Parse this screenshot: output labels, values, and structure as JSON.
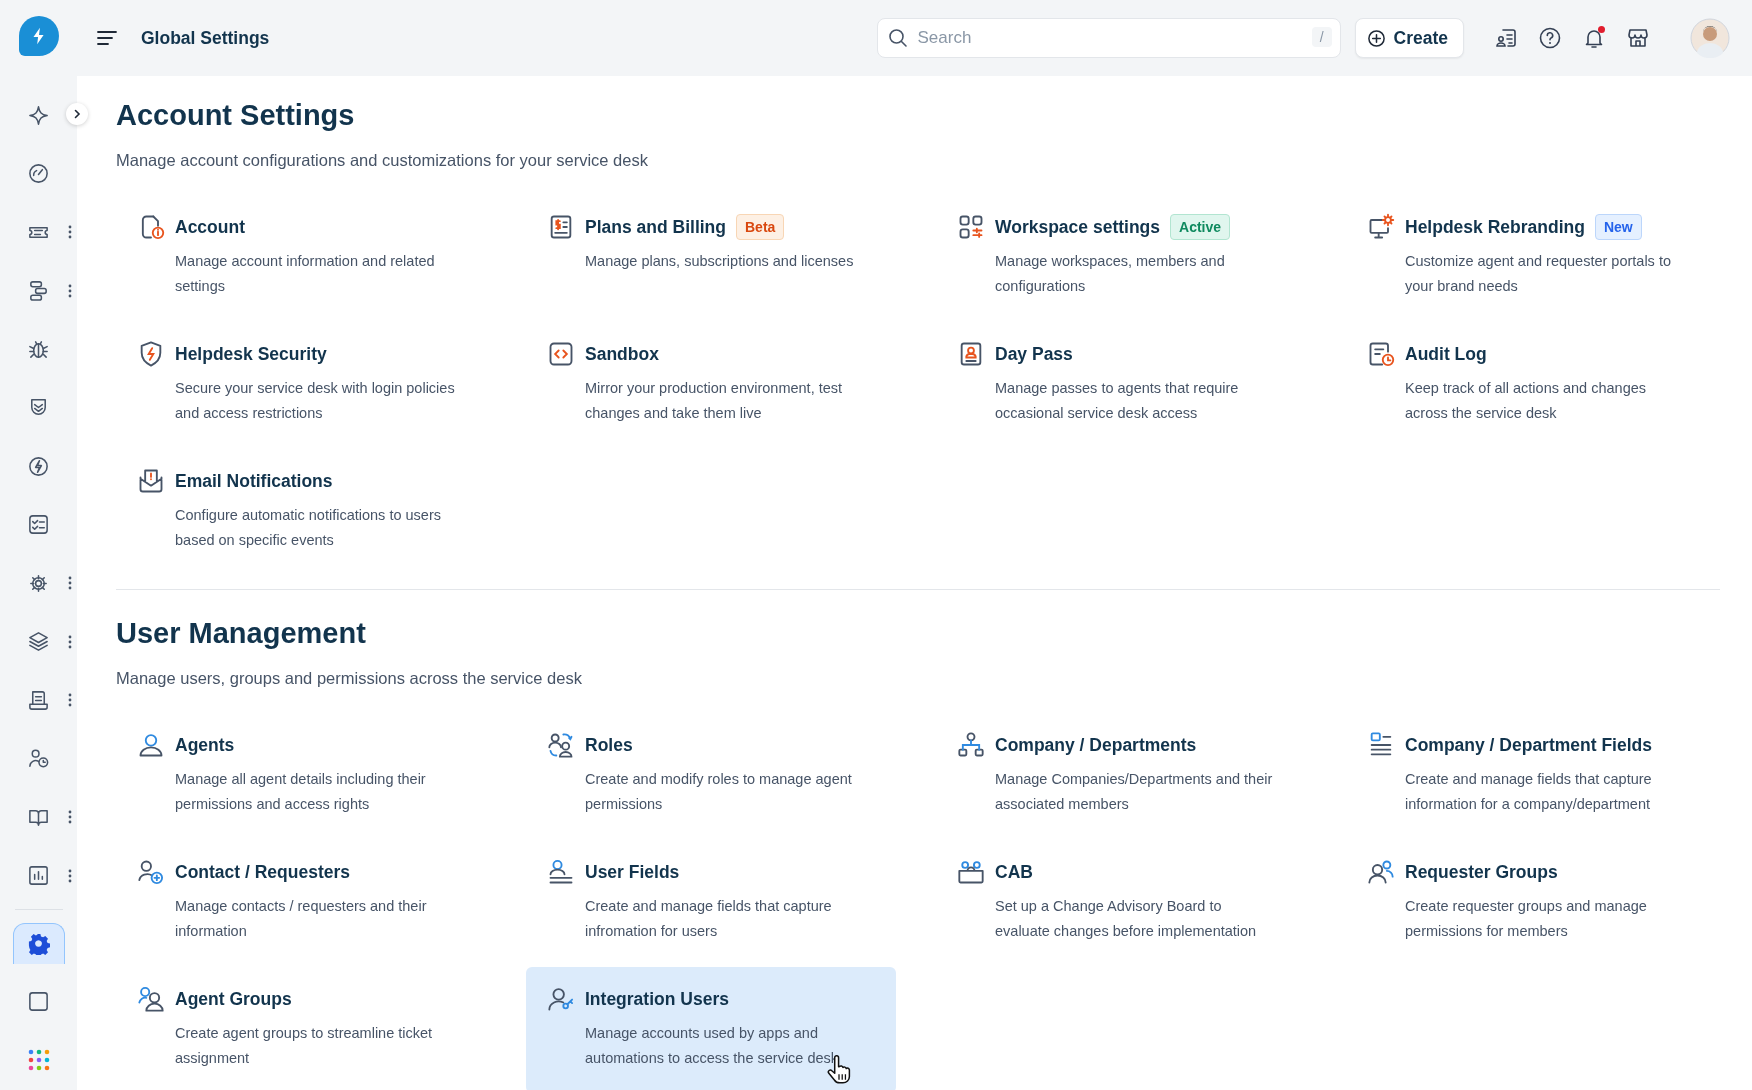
{
  "topbar": {
    "title": "Global Settings",
    "search": {
      "placeholder": "Search",
      "shortcut": "/"
    },
    "create_button": "Create",
    "notification_unread": true
  },
  "sidebar": {
    "items": [
      {
        "selected": false,
        "has_menu": false
      },
      {
        "selected": false,
        "has_menu": false
      },
      {
        "selected": false,
        "has_menu": true
      },
      {
        "selected": false,
        "has_menu": true
      },
      {
        "selected": false,
        "has_menu": false
      },
      {
        "selected": false,
        "has_menu": false
      },
      {
        "selected": false,
        "has_menu": false
      },
      {
        "selected": false,
        "has_menu": false
      },
      {
        "selected": false,
        "has_menu": true
      },
      {
        "selected": false,
        "has_menu": true
      },
      {
        "selected": false,
        "has_menu": true
      },
      {
        "selected": false,
        "has_menu": false
      },
      {
        "selected": false,
        "has_menu": true
      },
      {
        "selected": false,
        "has_menu": true
      },
      {
        "selected": true,
        "has_menu": false
      }
    ]
  },
  "sections": [
    {
      "title": "Account Settings",
      "subtitle": "Manage account configurations and customizations for your service desk",
      "items": [
        {
          "title": "Account",
          "description": "Manage account information and related settings",
          "selected": false
        },
        {
          "title": "Plans and Billing",
          "badge": {
            "text": "Beta",
            "kind": "beta"
          },
          "description": "Manage plans, subscriptions and licenses",
          "selected": false
        },
        {
          "title": "Workspace settings",
          "badge": {
            "text": "Active",
            "kind": "active"
          },
          "description": "Manage workspaces, members and configurations",
          "selected": false
        },
        {
          "title": "Helpdesk Rebranding",
          "badge": {
            "text": "New",
            "kind": "new"
          },
          "description": "Customize agent and requester portals to your brand needs",
          "selected": false
        },
        {
          "title": "Helpdesk Security",
          "description": "Secure your service desk with login policies and access restrictions",
          "selected": false
        },
        {
          "title": "Sandbox",
          "description": "Mirror your production environment, test changes and take them live",
          "selected": false
        },
        {
          "title": "Day Pass",
          "description": "Manage passes to agents that require occasional service desk access",
          "selected": false
        },
        {
          "title": "Audit Log",
          "description": "Keep track of all actions and changes across the service desk",
          "selected": false
        },
        {
          "title": "Email Notifications",
          "description": "Configure automatic notifications to users based on specific events",
          "selected": false
        }
      ]
    },
    {
      "title": "User Management",
      "subtitle": "Manage users, groups and permissions across the service desk",
      "items": [
        {
          "title": "Agents",
          "description": "Manage all agent details including their permissions and access rights",
          "selected": false
        },
        {
          "title": "Roles",
          "description": "Create and modify roles to manage agent permissions",
          "selected": false
        },
        {
          "title": "Company / Departments",
          "description": "Manage Companies/Departments and their associated members",
          "selected": false
        },
        {
          "title": "Company / Department Fields",
          "description": "Create and manage fields that capture information for a company/department",
          "selected": false
        },
        {
          "title": "Contact / Requesters",
          "description": "Manage contacts / requesters and their information",
          "selected": false
        },
        {
          "title": "User Fields",
          "description": "Create and manage fields that capture infromation for users",
          "selected": false
        },
        {
          "title": "CAB",
          "description": "Set up a Change Advisory Board to evaluate changes before implementation",
          "selected": false
        },
        {
          "title": "Requester Groups",
          "description": "Create requester groups and manage permissions for members",
          "selected": false
        },
        {
          "title": "Agent Groups",
          "description": "Create agent groups to streamline ticket assignment",
          "selected": false
        },
        {
          "title": "Integration Users",
          "description": "Manage accounts used by apps and automations to access the service desk",
          "selected": true
        }
      ]
    }
  ]
}
